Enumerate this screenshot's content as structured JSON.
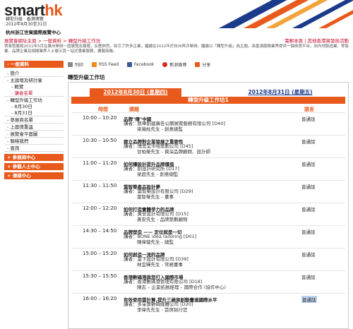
{
  "header": {
    "logo_main": "smart",
    "logo_accent": "hk",
    "logo_line1": "轉型升級 · 香港博覽",
    "logo_line2": "2012年8月30至31日",
    "logo_line3": "杭州國際博覽中心",
    "logo_venue": "杭州浙江世貿國際展覽中心",
    "stripe_colors": [
      "#1a3a8a",
      "#e85a1b",
      "#f2a33a",
      "#e85a1b",
      "#ffffff"
    ]
  },
  "breadcrumb": [
    "展覽會網址主頁",
    "一般資料",
    "轉型升級工作坊"
  ],
  "toplinks": [
    "電郵本頁",
    "其他香港貿發局活動"
  ],
  "intro": "貿易發展局2011年5月在廣州舉辦一屆展覽及論壇，反應熱烈，吸引了許多企業，繼續在2012年於杭州再次舉辦，繼續以「轉型升級」為主題，為香港服務業界提供一個商貿平台，向內地製造業、零售業、品牌企業及相關業界人士展示其一站式專業服務，擴展商機。",
  "sidebar": {
    "head": "一般資料",
    "items": [
      "簡介",
      "主論壇及研討會",
      "概覽",
      "講者名單",
      "轉型升級工作坊",
      "8月30日",
      "8月31日",
      "參展商名單",
      "上届情重溫",
      "展覽會平面圖",
      "聯絡我們",
      "查詢"
    ],
    "bars": [
      "參展商中心",
      "參觀人士中心",
      "傳媒中心"
    ]
  },
  "share": {
    "print": "列印",
    "rss": "RSS Feed",
    "facebook": "Facebook",
    "weibo": "新浪微博",
    "share": "分享"
  },
  "page_title": "轉型升級工作坊",
  "tabs": {
    "active": "2012年8月30日 (星期四)",
    "inactive": "2012年8月31日 (星期五)"
  },
  "room": "轉型升級工作坊1",
  "columns": {
    "time": "時間",
    "topic": "講題",
    "lang": "語言"
  },
  "sessions": [
    {
      "time": "10:00 – 10:20",
      "topic": "品牌\"傳\"中國",
      "speaker1": "講者：凱華創建廣告公關展覽服務有限公司 [D40]",
      "speaker2": "梁瀚柱先生 - 創意總監",
      "lang": "普通話"
    },
    {
      "time": "10:30 – 10:50",
      "topic": "建立品牌對企業發展之重要性",
      "speaker1": "講者：博思堂市場策劃公司 [D45]",
      "speaker2": "甘柏榮先生 - 資深品牌顧問、設計師",
      "lang": "普通話"
    },
    {
      "time": "11:00 – 11:20",
      "topic": "如何讓設計提升品牌價值",
      "speaker1": "講者：創設計研究所 [D17]",
      "speaker2": "梁超先生 - 創意總監",
      "lang": "普通話"
    },
    {
      "time": "11:30 – 11:50",
      "topic": "葉智榮產品設計夢",
      "speaker1": "講者：葉智榮設計有限公司 [D29]",
      "speaker2": "葉智榮先生 - 董事",
      "lang": "普通話"
    },
    {
      "time": "12:00 – 12:20",
      "topic": "如何打造實體爭力的品牌",
      "speaker1": "講者：黃安設計有限公司 [D15]",
      "speaker2": "黃安先生 - 品牌策劃顧問",
      "lang": "普通話"
    },
    {
      "time": "14:30 – 14:50",
      "topic": "品牌塑造 —— 定位就是一切",
      "speaker1": "講者：BONE idea tailoring [D01]",
      "speaker2": "陳偉璇先生 - 總監",
      "lang": "普通話"
    },
    {
      "time": "15:00 – 15:20",
      "topic": "如何創造一流的品牌",
      "speaker1": "講者：當下設計有限公司 [D39]",
      "speaker2": "林宜輝先生 - 常務董事",
      "lang": "普通話"
    },
    {
      "time": "15:30 – 15:50",
      "topic": "香港數碼港與您打入國際市場",
      "speaker1": "講者：香港數碼港管理有限公司 [D18]",
      "speaker2": "陳志 – 企業拓展經理 – 國際合作 (協作中心)",
      "lang": "普通話"
    },
    {
      "time": "16:00 – 16:20",
      "topic": "有效使用雲計算,提升三維原創動畫達國際水平",
      "speaker1": "講者：多采實數碼媒體公司 [D20]",
      "speaker2": "李偉先先生 - 首席執行官",
      "lang": "普通話"
    }
  ]
}
